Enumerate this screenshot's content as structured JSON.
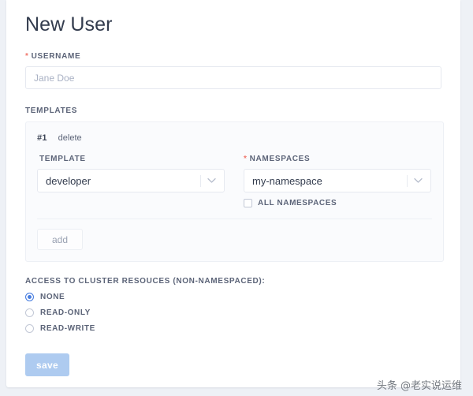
{
  "page": {
    "title": "New User",
    "background_color": "#eef1f6",
    "card_color": "#ffffff"
  },
  "username": {
    "label": "USERNAME",
    "required_marker": "*",
    "value": "",
    "placeholder": "Jane Doe"
  },
  "templates": {
    "section_label": "TEMPLATES",
    "entries": [
      {
        "index_label": "#1",
        "delete_label": "delete",
        "template": {
          "label": "TEMPLATE",
          "required_marker": "",
          "selected": "developer"
        },
        "namespaces": {
          "label": "NAMESPACES",
          "required_marker": "*",
          "selected": "my-namespace",
          "all_namespaces_label": "ALL NAMESPACES",
          "all_namespaces_checked": false
        }
      }
    ],
    "add_label": "add"
  },
  "access": {
    "title": "ACCESS TO CLUSTER RESOUCES (NON-NAMESPACED):",
    "options": [
      {
        "label": "NONE",
        "selected": true
      },
      {
        "label": "READ-ONLY",
        "selected": false
      },
      {
        "label": "READ-WRITE",
        "selected": false
      }
    ]
  },
  "actions": {
    "save_label": "save",
    "save_color": "#aecbf0"
  },
  "watermark": {
    "text": "头条 @老实说运维"
  },
  "colors": {
    "required_star": "#f0776c",
    "radio_accent": "#4a7fe0",
    "label_text": "#5c6478",
    "title_text": "#333c4e"
  }
}
